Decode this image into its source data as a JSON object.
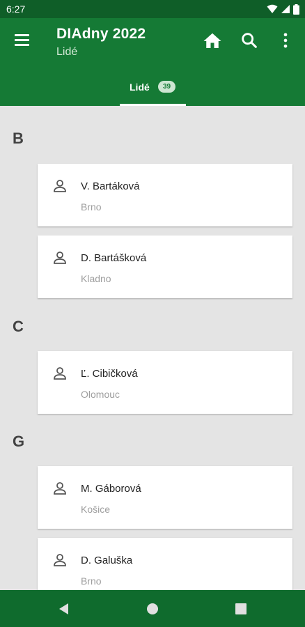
{
  "status_bar": {
    "time": "6:27",
    "icons": [
      "wifi-icon",
      "signal-icon",
      "battery-icon"
    ]
  },
  "app_bar": {
    "title": "DIAdny 2022",
    "subtitle": "Lidé",
    "actions": [
      "home-icon",
      "search-icon",
      "more-vert-icon"
    ]
  },
  "tab": {
    "label": "Lidé",
    "badge": "39"
  },
  "sections": [
    {
      "letter": "B",
      "people": [
        {
          "name": "V. Bartáková",
          "city": "Brno"
        },
        {
          "name": "D. Bartášková",
          "city": "Kladno"
        }
      ]
    },
    {
      "letter": "C",
      "people": [
        {
          "name": "Ľ. Cibičková",
          "city": "Olomouc"
        }
      ]
    },
    {
      "letter": "G",
      "people": [
        {
          "name": "M. Gáborová",
          "city": "Košice"
        },
        {
          "name": "D. Galuška",
          "city": "Brno"
        }
      ]
    }
  ],
  "nav_bar": [
    "back-icon",
    "home-circle-icon",
    "recents-icon"
  ],
  "colors": {
    "app_bar": "#157a35",
    "status_bar": "#0f5e28",
    "nav_bar": "#0f6b2d",
    "background": "#e4e4e4"
  }
}
